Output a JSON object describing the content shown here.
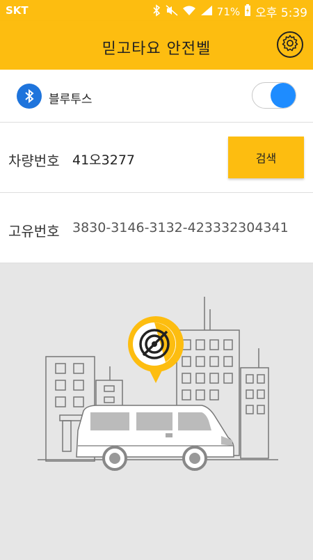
{
  "status": {
    "carrier": "SKT",
    "battery": "71%",
    "time": "오후 5:39"
  },
  "appbar": {
    "title": "믿고타요 안전벨",
    "settings_icon": "gear-icon"
  },
  "bluetooth": {
    "label": "블루투스",
    "icon": "bluetooth-icon",
    "enabled": true
  },
  "vehicle": {
    "label": "차량번호",
    "value": "41오3277",
    "search_label": "검색"
  },
  "device": {
    "label": "고유번호",
    "value": "3830-3146-3132-423332304341"
  },
  "colors": {
    "accent": "#fdbd10",
    "toggle_on": "#1e8cff",
    "bluetooth": "#1e74dc",
    "background": "#e6e6e6"
  }
}
